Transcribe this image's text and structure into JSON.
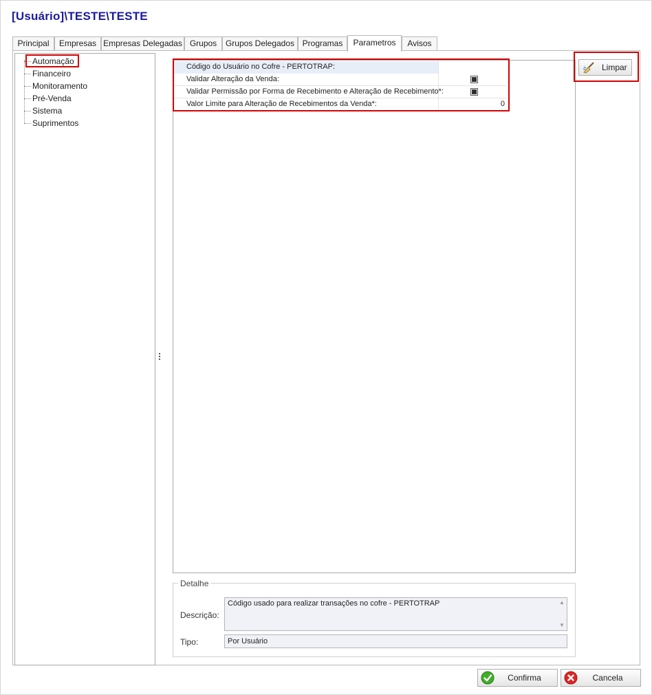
{
  "window": {
    "title": "[Usuário]\\TESTE\\TESTE"
  },
  "tabs": [
    {
      "label": "Principal",
      "active": false
    },
    {
      "label": "Empresas",
      "active": false
    },
    {
      "label": "Empresas Delegadas",
      "active": false
    },
    {
      "label": "Grupos",
      "active": false
    },
    {
      "label": "Grupos Delegados",
      "active": false
    },
    {
      "label": "Programas",
      "active": false
    },
    {
      "label": "Parametros",
      "active": true
    },
    {
      "label": "Avisos",
      "active": false
    }
  ],
  "tree": {
    "items": [
      {
        "label": "Automação",
        "selected": true
      },
      {
        "label": "Financeiro"
      },
      {
        "label": "Monitoramento"
      },
      {
        "label": "Pré-Venda"
      },
      {
        "label": "Sistema"
      },
      {
        "label": "Suprimentos"
      }
    ]
  },
  "grid": {
    "rows": [
      {
        "label": "Código do Usuário no Cofre - PERTOTRAP:",
        "value": "",
        "type": "text",
        "selected": true
      },
      {
        "label": "Validar Alteração da Venda:",
        "value": "",
        "type": "checkbox",
        "checked": true
      },
      {
        "label": "Validar Permissão por Forma de Recebimento e Alteração de Recebimento*:",
        "value": "",
        "type": "checkbox",
        "checked": true
      },
      {
        "label": "Valor Limite para Alteração de Recebimentos da Venda*:",
        "value": "0",
        "type": "number"
      }
    ]
  },
  "toolbar": {
    "limpar_label": "Limpar"
  },
  "detail": {
    "legend": "Detalhe",
    "descricao_label": "Descrição:",
    "descricao_value": "Código usado para realizar transações no cofre - PERTOTRAP",
    "tipo_label": "Tipo:",
    "tipo_value": "Por Usuário"
  },
  "footer": {
    "confirma_label": "Confirma",
    "cancela_label": "Cancela"
  },
  "colors": {
    "title": "#1a1aa0",
    "highlight": "#d20000",
    "selected_row": "#e8eef8"
  },
  "icons": {
    "limpar": "broom-icon",
    "confirma": "check-circle-icon",
    "cancela": "x-circle-icon"
  }
}
